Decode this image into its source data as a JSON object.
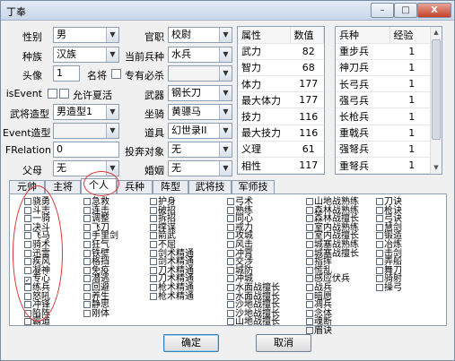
{
  "window": {
    "title": "丁奉",
    "min": "–",
    "max": "□",
    "close": "X"
  },
  "form": {
    "gender_label": "性别",
    "gender": "男",
    "ethnicity_label": "种族",
    "ethnicity": "汉族",
    "avatar_label": "头像",
    "avatar": "1",
    "famous_label": "名将",
    "is_event_label": "isEvent",
    "allow_summer_label": "允许夏活",
    "model_label": "武将造型",
    "model": "男造型1",
    "event_model_label": "Event造型",
    "event_model": "",
    "frelation_label": "FRelation",
    "frelation": "0",
    "father_label": "父母",
    "father": "无",
    "office_label": "官职",
    "office": "校尉",
    "troop_label": "当前兵种",
    "troop": "水兵",
    "special_label": "专有必杀",
    "special": "",
    "weapon_label": "武器",
    "weapon": "钢长刀",
    "mount_label": "坐骑",
    "mount": "黄骠马",
    "item_label": "道具",
    "item": "幻世录II",
    "surrender_label": "投奔对象",
    "surrender": "无",
    "spouse_label": "婚姻",
    "spouse": "无"
  },
  "attrs": {
    "headers": [
      "属性",
      "数值"
    ],
    "rows": [
      [
        "武力",
        "82"
      ],
      [
        "智力",
        "68"
      ],
      [
        "体力",
        "177"
      ],
      [
        "最大体力",
        "177"
      ],
      [
        "技力",
        "116"
      ],
      [
        "最大技力",
        "116"
      ],
      [
        "义理",
        "61"
      ],
      [
        "相性",
        "117"
      ]
    ]
  },
  "troops": {
    "headers": [
      "兵种",
      "经验"
    ],
    "rows": [
      [
        "重步兵",
        "1"
      ],
      [
        "神刀兵",
        "1"
      ],
      [
        "长弓兵",
        "1"
      ],
      [
        "强弓兵",
        "1"
      ],
      [
        "长枪兵",
        "1"
      ],
      [
        "重戟兵",
        "1"
      ],
      [
        "强弩兵",
        "1"
      ],
      [
        "重弩兵",
        "1"
      ]
    ]
  },
  "tabs": [
    "元帅",
    "主将",
    "个人",
    "兵种",
    "阵型",
    "武将技",
    "军师技"
  ],
  "active_tab": 2,
  "skills": [
    [
      "骁勇",
      "斗志",
      "一骑",
      "决斗",
      "飞马",
      "骑术",
      "迅雷",
      "疾风",
      "凝神",
      "专心",
      "练兵",
      "怒吼",
      "冲锋",
      "陷阵",
      "霸道"
    ],
    [
      "急救",
      "连击",
      "调整",
      "飞刀",
      "手里剑",
      "狂气",
      "铁壁",
      "格挡",
      "免疫",
      "潜逃",
      "回避",
      "养生",
      "静思",
      "刚体"
    ],
    [
      "护身",
      "破招",
      "拆招",
      "撑谋",
      "箭武",
      "不屈",
      "剑术精通",
      "剑术精通",
      "刀术精通",
      "刀术精通",
      "枪术精通",
      "枪术精通"
    ],
    [
      "弓术",
      "熟练",
      "同心",
      "戒力",
      "攻城",
      "风击",
      "冲霄",
      "交涉",
      "城防",
      "冲城",
      "水面战擅长",
      "水面战擅长",
      "沙地战擅长",
      "沙地战擅长",
      "山地战擅长"
    ],
    [
      "山地战熟练",
      "森林战熟练",
      "森林战擅长",
      "室内战熟练",
      "室内战擅长",
      "城塞战熟练",
      "城塞战擅长",
      "指挥",
      "慌乱",
      "感应伏兵",
      "战兵",
      "暗愿",
      "凋兵",
      "念体",
      "魂断",
      "眉诀"
    ],
    [
      "刀诀",
      "枪诀",
      "弓诀",
      "慧剑",
      "锻造",
      "冶炼",
      "击剑",
      "弄船",
      "舞刀",
      "骑射",
      "操弓"
    ]
  ],
  "checked": {
    "col0": [
      9
    ]
  },
  "buttons": {
    "ok": "确定",
    "cancel": "取消"
  }
}
